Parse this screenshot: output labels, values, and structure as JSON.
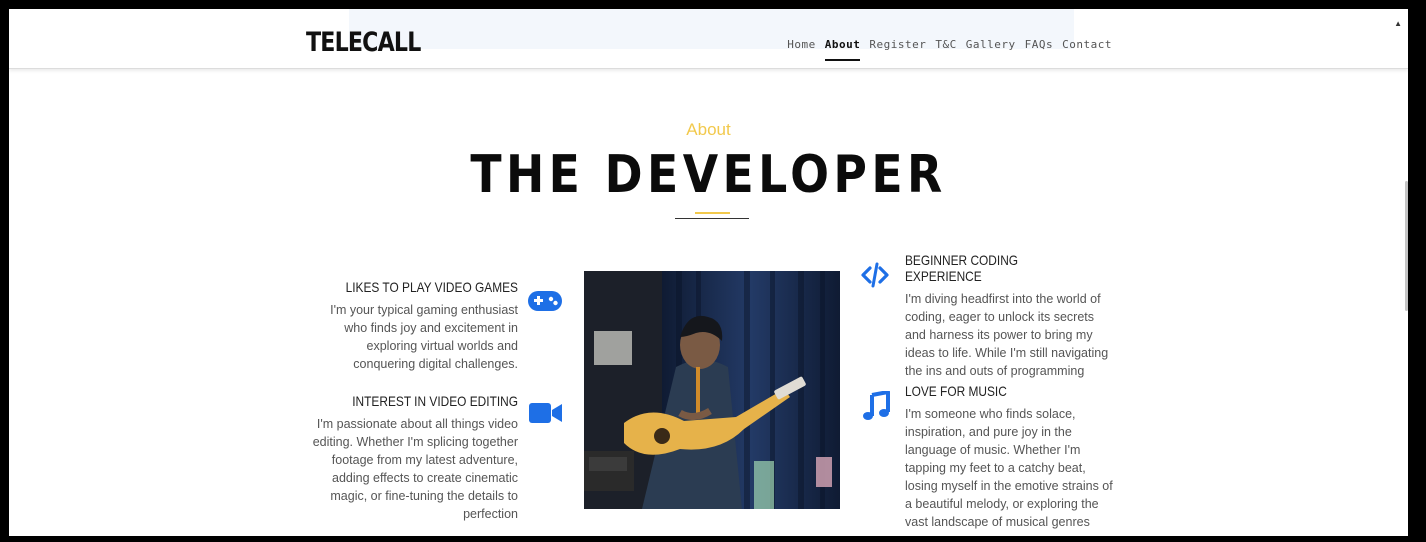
{
  "brand": "TELECALL",
  "nav": {
    "items": [
      "Home",
      "About",
      "Register",
      "T&C",
      "Gallery",
      "FAQs",
      "Contact"
    ],
    "active": "About"
  },
  "section": {
    "kicker": "About",
    "title": "THE DEVELOPER"
  },
  "features": {
    "gaming": {
      "title": "LIKES TO PLAY VIDEO GAMES",
      "text": "I'm your typical gaming enthusiast who finds joy and excitement in exploring virtual worlds and conquering digital challenges.",
      "icon": "gamepad-icon"
    },
    "editing": {
      "title": "INTEREST IN VIDEO EDITING",
      "text": "I'm passionate about all things video editing. Whether I'm splicing together footage from my latest adventure, adding effects to create cinematic magic, or fine-tuning the details to perfection",
      "icon": "video-camera-icon"
    },
    "coding": {
      "title": "BEGINNER CODING EXPERIENCE",
      "text": "I'm diving headfirst into the world of coding, eager to unlock its secrets and harness its power to bring my ideas to life. While I'm still navigating the ins and outs of programming",
      "icon": "code-icon"
    },
    "music": {
      "title": "LOVE FOR MUSIC",
      "text": "I'm someone who finds solace, inspiration, and pure joy in the language of music. Whether I'm tapping my feet to a catchy beat, losing myself in the emotive strains of a beautiful melody, or exploring the vast landscape of musical genres",
      "icon": "music-note-icon"
    }
  },
  "colors": {
    "accent": "#f2c94c",
    "icon": "#1e6fe6",
    "title": "#0b0b0b"
  }
}
